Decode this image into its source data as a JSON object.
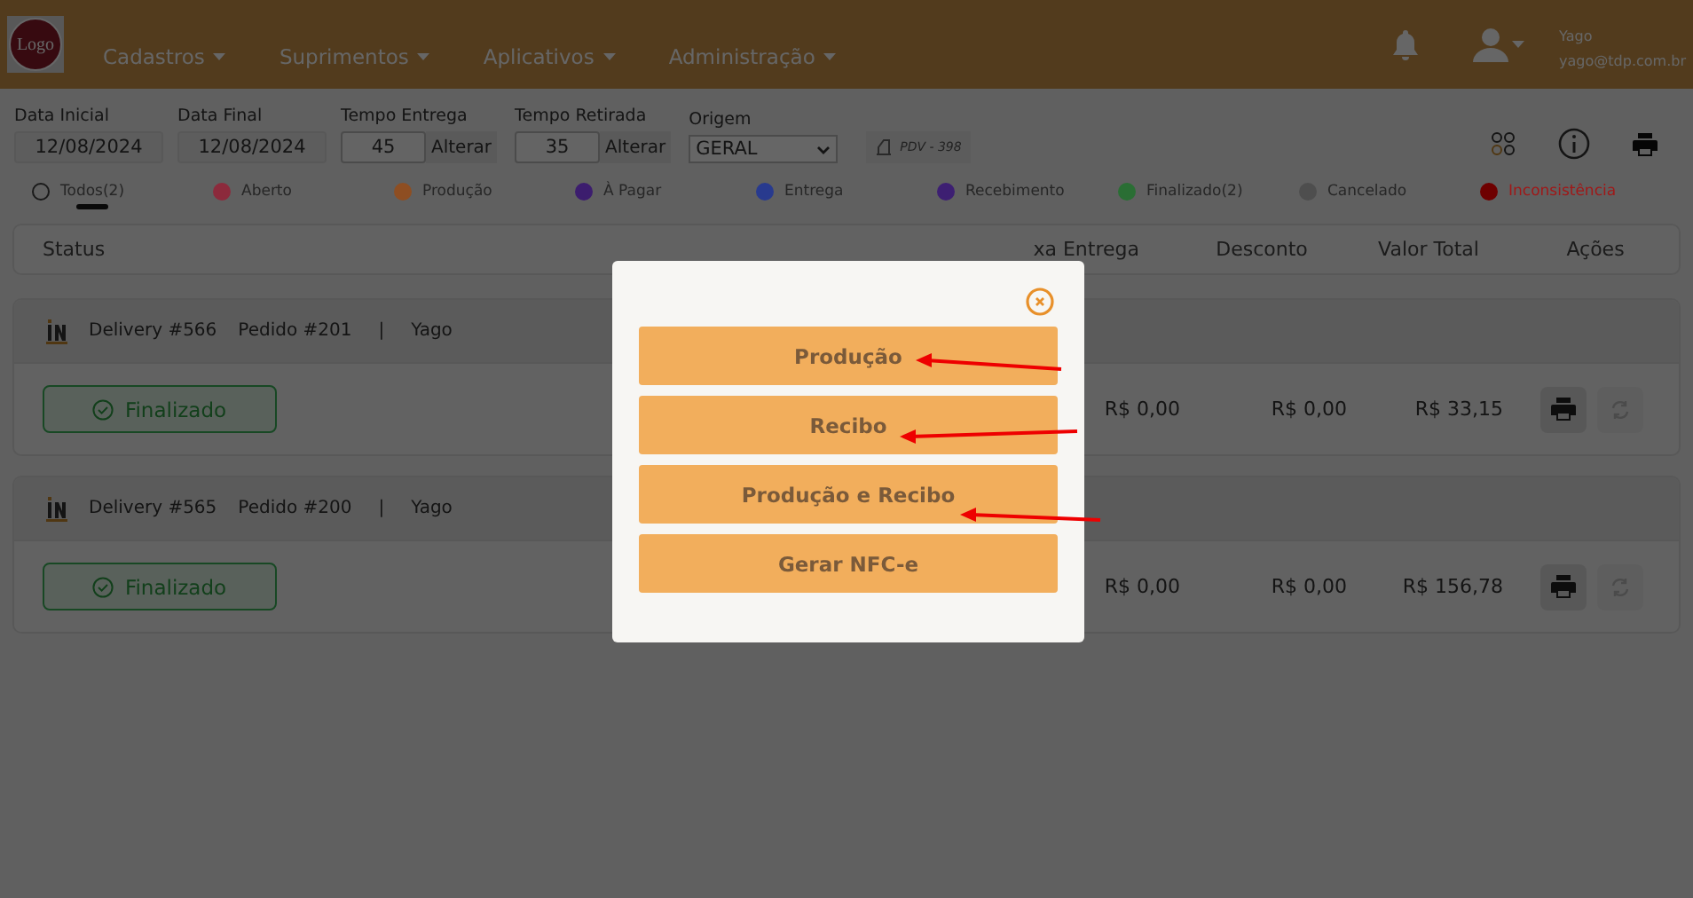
{
  "navbar": {
    "logo": "Logo",
    "menus": [
      "Cadastros",
      "Suprimentos",
      "Aplicativos",
      "Administração"
    ],
    "user": {
      "name": "Yago",
      "email": "yago@tdp.com.br"
    }
  },
  "filters": {
    "fields": [
      {
        "label": "Data Inicial",
        "value": "12/08/2024"
      },
      {
        "label": "Data Final",
        "value": "12/08/2024"
      }
    ],
    "times": [
      {
        "label": "Tempo Entrega",
        "value": "45",
        "action": "Alterar"
      },
      {
        "label": "Tempo Retirada",
        "value": "35",
        "action": "Alterar"
      }
    ],
    "origin": {
      "label": "Origem",
      "value": "GERAL"
    },
    "pdv": "PDV - 398"
  },
  "status_filters": [
    {
      "kind": "all",
      "label": "Todos(2)",
      "selected": true
    },
    {
      "kind": "status",
      "label": "Aberto",
      "color": "#8c2a3c",
      "selected": false
    },
    {
      "kind": "status",
      "label": "Produção",
      "color": "#8e4e22",
      "selected": false
    },
    {
      "kind": "status",
      "label": "À Pagar",
      "color": "#3c1d6e",
      "selected": false
    },
    {
      "kind": "status",
      "label": "Entrega",
      "color": "#283a8e",
      "selected": false
    },
    {
      "kind": "status",
      "label": "Recebimento",
      "color": "#3d1f72",
      "selected": false
    },
    {
      "kind": "status",
      "label": "Finalizado(2)",
      "color": "#2a6e34",
      "selected": false
    },
    {
      "kind": "status",
      "label": "Cancelado",
      "color": "#4e4e4e",
      "selected": false
    },
    {
      "kind": "alert",
      "label": "Inconsistência",
      "color": "#6e0000",
      "selected": false
    }
  ],
  "table": {
    "columns": [
      "Status",
      "xa Entrega",
      "Desconto",
      "Valor Total",
      "Ações"
    ],
    "rows": [
      {
        "delivery": "Delivery #566",
        "order": "Pedido #201",
        "separator": "|",
        "customer": "Yago",
        "status": "Finalizado",
        "fee": "R$ 0,00",
        "discount": "R$ 0,00",
        "total": "R$ 33,15"
      },
      {
        "delivery": "Delivery #565",
        "order": "Pedido #200",
        "separator": "|",
        "customer": "Yago",
        "status": "Finalizado",
        "fee": "R$ 0,00",
        "discount": "R$ 0,00",
        "total": "R$ 156,78"
      }
    ]
  },
  "modal": {
    "buttons": [
      {
        "label": "Produção",
        "arrow": true
      },
      {
        "label": "Recibo",
        "arrow": true
      },
      {
        "label": "Produção e Recibo",
        "arrow": true
      },
      {
        "label": "Gerar NFC-e",
        "arrow": false
      }
    ]
  }
}
